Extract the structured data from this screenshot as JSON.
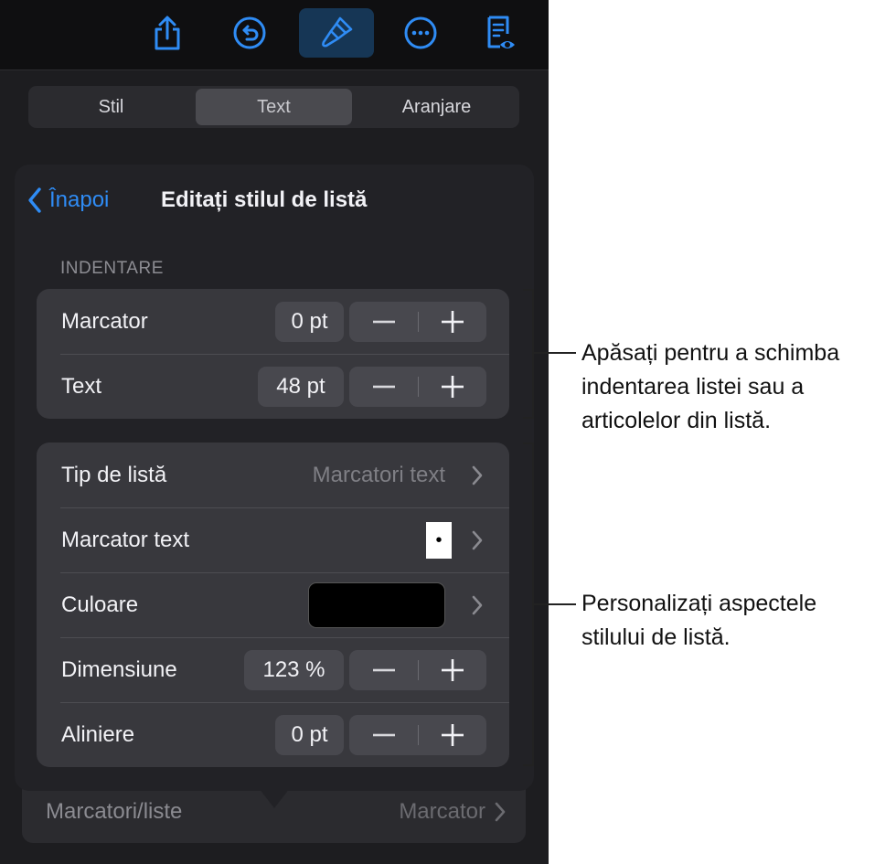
{
  "toolbar": {
    "buttons": [
      {
        "name": "share-icon"
      },
      {
        "name": "undo-icon"
      },
      {
        "name": "format-brush-icon",
        "active": true
      },
      {
        "name": "more-icon"
      },
      {
        "name": "reader-view-icon"
      }
    ],
    "accent": "#2f8cf5",
    "active_bg": "#163655"
  },
  "segments": {
    "items": [
      "Stil",
      "Text",
      "Aranjare"
    ],
    "selected": "Text"
  },
  "popover": {
    "back_label": "Înapoi",
    "title": "Editați stilul de listă",
    "section_label": "INDENTARE",
    "indent_rows": [
      {
        "label": "Marcator",
        "value": "0 pt"
      },
      {
        "label": "Text",
        "value": "48 pt"
      }
    ],
    "style_rows": {
      "list_type": {
        "label": "Tip de listă",
        "value": "Marcatori text"
      },
      "text_bullet": {
        "label": "Marcator text",
        "value": "•"
      },
      "color": {
        "label": "Culoare",
        "swatch": "#000000"
      },
      "size": {
        "label": "Dimensiune",
        "value": "123 %"
      },
      "alignment": {
        "label": "Aliniere",
        "value": "0 pt"
      }
    }
  },
  "background_row": {
    "label": "Marcatori/liste",
    "value": "Marcator"
  },
  "callouts": {
    "indent": [
      "Apăsați pentru a schimba",
      "indentarea listei sau a",
      "articolelor din listă."
    ],
    "style": [
      "Personalizați aspectele",
      "stilului de listă."
    ]
  }
}
